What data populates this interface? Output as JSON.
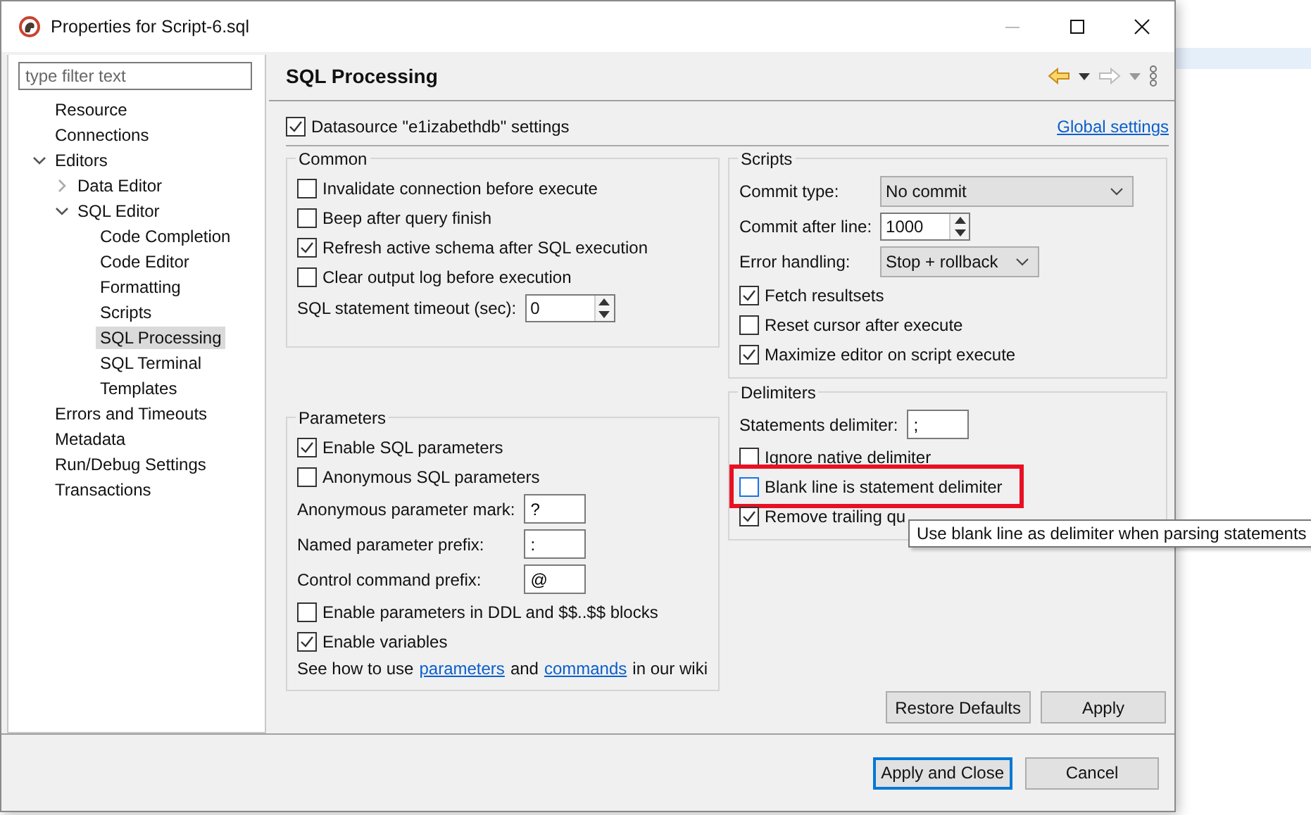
{
  "window": {
    "title": "Properties for Script-6.sql"
  },
  "filter": {
    "placeholder": "type filter text"
  },
  "tree": [
    {
      "label": "Resource",
      "selected": false
    },
    {
      "label": "Connections",
      "selected": false
    },
    {
      "label": "Editors",
      "selected": false,
      "expanded": true,
      "children": [
        {
          "label": "Data Editor",
          "selected": false,
          "expanded": false
        },
        {
          "label": "SQL Editor",
          "selected": false,
          "expanded": true,
          "children": [
            {
              "label": "Code Completion",
              "selected": false
            },
            {
              "label": "Code Editor",
              "selected": false
            },
            {
              "label": "Formatting",
              "selected": false
            },
            {
              "label": "Scripts",
              "selected": false
            },
            {
              "label": "SQL Processing",
              "selected": true
            },
            {
              "label": "SQL Terminal",
              "selected": false
            },
            {
              "label": "Templates",
              "selected": false
            }
          ]
        }
      ]
    },
    {
      "label": "Errors and Timeouts",
      "selected": false
    },
    {
      "label": "Metadata",
      "selected": false
    },
    {
      "label": "Run/Debug Settings",
      "selected": false
    },
    {
      "label": "Transactions",
      "selected": false
    }
  ],
  "page": {
    "title": "SQL Processing",
    "datasource": {
      "label": "Datasource \"e1izabethdb\" settings",
      "checked": true
    },
    "global_link": "Global settings"
  },
  "groups_left": [
    {
      "title": "Common",
      "rows": [
        {
          "kind": "checkbox",
          "label": "Invalidate connection before execute",
          "checked": false
        },
        {
          "kind": "checkbox",
          "label": "Beep after query finish",
          "checked": false
        },
        {
          "kind": "checkbox",
          "label": "Refresh active schema after SQL execution",
          "checked": true
        },
        {
          "kind": "checkbox",
          "label": "Clear output log before execution",
          "checked": false
        },
        {
          "kind": "spinner",
          "label": "SQL statement timeout (sec):",
          "value": "0"
        }
      ]
    },
    {
      "title": "Parameters",
      "rows": [
        {
          "kind": "checkbox",
          "label": "Enable SQL parameters",
          "checked": true
        },
        {
          "kind": "checkbox",
          "label": "Anonymous SQL parameters",
          "checked": false
        },
        {
          "kind": "text",
          "label": "Anonymous parameter mark:",
          "value": "?"
        },
        {
          "kind": "text",
          "label": "Named parameter prefix:",
          "value": ":"
        },
        {
          "kind": "text",
          "label": "Control command prefix:",
          "value": "@"
        },
        {
          "kind": "checkbox",
          "label": "Enable parameters in DDL and $$..$$ blocks",
          "checked": false
        },
        {
          "kind": "checkbox",
          "label": "Enable variables",
          "checked": true
        },
        {
          "kind": "note",
          "parts": [
            {
              "kind": "text",
              "text": "See how to use"
            },
            {
              "kind": "link",
              "text": "parameters"
            },
            {
              "kind": "text",
              "text": "and"
            },
            {
              "kind": "link",
              "text": "commands"
            },
            {
              "kind": "text",
              "text": "in our wiki"
            }
          ]
        }
      ]
    }
  ],
  "groups_right": [
    {
      "title": "Scripts",
      "rows": [
        {
          "kind": "combo",
          "label": "Commit type:",
          "value": "No commit"
        },
        {
          "kind": "spinner",
          "label": "Commit after line:",
          "value": "1000"
        },
        {
          "kind": "combo",
          "label": "Error handling:",
          "value": "Stop + rollback"
        },
        {
          "kind": "checkbox",
          "label": "Fetch resultsets",
          "checked": true
        },
        {
          "kind": "checkbox",
          "label": "Reset cursor after execute",
          "checked": false
        },
        {
          "kind": "checkbox",
          "label": "Maximize editor on script execute",
          "checked": true
        }
      ]
    },
    {
      "title": "Delimiters",
      "rows": [
        {
          "kind": "text",
          "label": "Statements delimiter:",
          "value": ";"
        },
        {
          "kind": "checkbox",
          "label": "Ignore native delimiter",
          "checked": false
        },
        {
          "kind": "checkbox",
          "label": "Blank line is statement delimiter",
          "checked": false,
          "highlighted": true
        },
        {
          "kind": "checkbox",
          "label": "Remove trailing qu",
          "checked": true
        }
      ],
      "tooltip": "Use blank line as delimiter when parsing statements"
    }
  ],
  "page_buttons": [
    "Restore Defaults",
    "Apply"
  ],
  "dialog_buttons": [
    {
      "label": "Apply and Close",
      "default": true
    },
    {
      "label": "Cancel",
      "default": false
    }
  ]
}
